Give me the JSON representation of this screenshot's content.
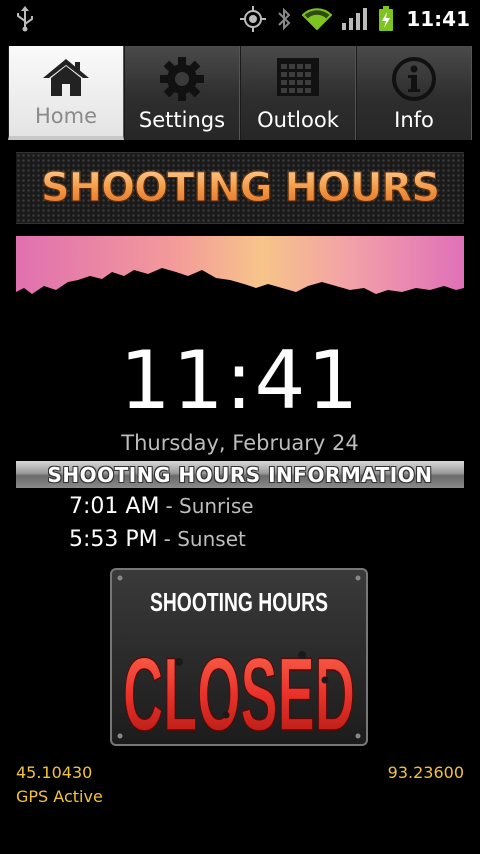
{
  "status_bar": {
    "time": "11:41",
    "icons": [
      "usb-icon",
      "gps-icon",
      "bluetooth-icon",
      "wifi-icon",
      "signal-icon",
      "battery-charging-icon"
    ]
  },
  "tabs": [
    {
      "label": "Home",
      "icon": "home-icon",
      "active": true
    },
    {
      "label": "Settings",
      "icon": "gear-icon",
      "active": false
    },
    {
      "label": "Outlook",
      "icon": "calendar-icon",
      "active": false
    },
    {
      "label": "Info",
      "icon": "info-icon",
      "active": false
    }
  ],
  "banner": {
    "title": "SHOOTING HOURS"
  },
  "clock": {
    "time": "11:41",
    "date": "Thursday, February 24"
  },
  "info": {
    "header": "SHOOTING HOURS INFORMATION",
    "sunrise_time": "7:01 AM",
    "sunrise_label": "- Sunrise",
    "sunset_time": "5:53 PM",
    "sunset_label": "- Sunset"
  },
  "status_sign": {
    "top_text": "SHOOTING HOURS",
    "main_text": "CLOSED"
  },
  "gps": {
    "latitude": "45.10430",
    "longitude": "93.23600",
    "status": "GPS Active"
  },
  "colors": {
    "accent": "#f2c33a",
    "wifi": "#7ec31f",
    "closed": "#e8322a"
  }
}
